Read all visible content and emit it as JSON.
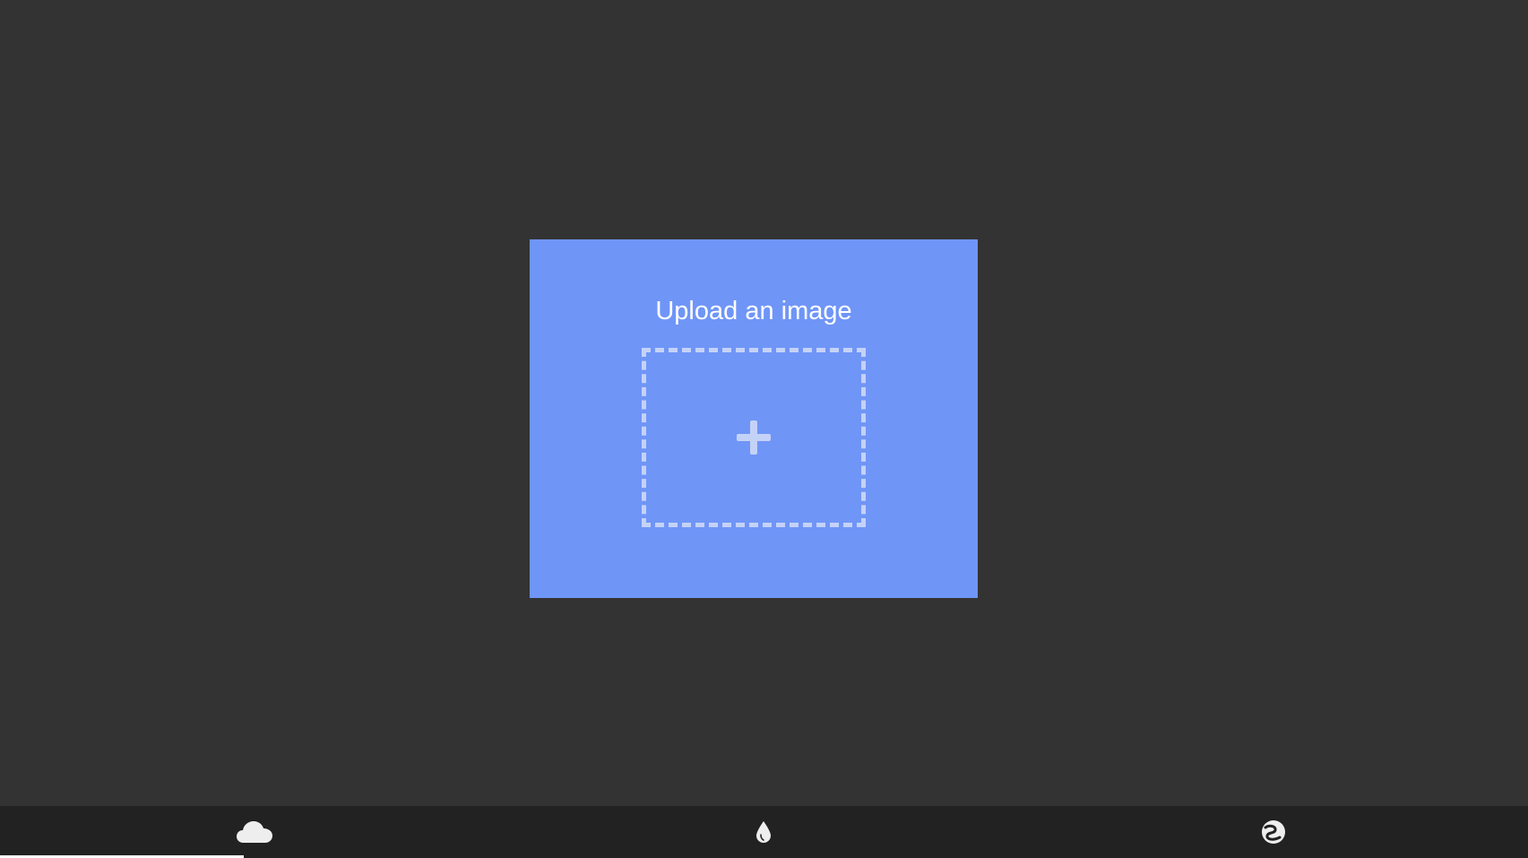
{
  "upload": {
    "title": "Upload an image",
    "add_icon": "plus-icon"
  },
  "bottom_nav": {
    "tabs": [
      {
        "icon": "cloud-icon",
        "active": true
      },
      {
        "icon": "drop-icon",
        "active": false
      },
      {
        "icon": "swirl-icon",
        "active": false
      }
    ]
  },
  "colors": {
    "background": "#333333",
    "card": "#6f95f7",
    "dashed_border": "#c5d2f7",
    "bottom_bar": "#222222",
    "icon": "#eeeeee"
  }
}
